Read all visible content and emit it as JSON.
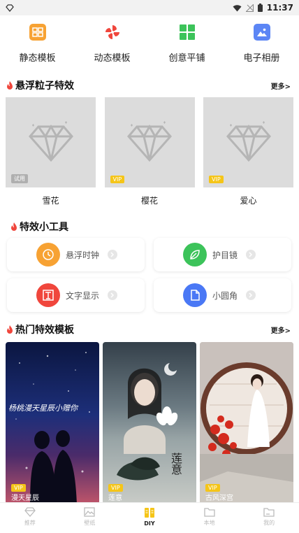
{
  "status_bar": {
    "time": "11:37"
  },
  "quick_categories": [
    {
      "label": "静态模板",
      "icon": "static-template-icon",
      "color": "#f7a233"
    },
    {
      "label": "动态模板",
      "icon": "pinwheel-icon",
      "color": "#f0463c"
    },
    {
      "label": "创意平铺",
      "icon": "grid-icon",
      "color": "#3cc35a"
    },
    {
      "label": "电子相册",
      "icon": "photo-album-icon",
      "color": "#5c86f5"
    }
  ],
  "particle_section": {
    "title": "悬浮粒子特效",
    "more": "更多>"
  },
  "particle_items": [
    {
      "name": "雪花",
      "badge": "试用",
      "badge_type": "trial"
    },
    {
      "name": "樱花",
      "badge": "VIP",
      "badge_type": "vip"
    },
    {
      "name": "爱心",
      "badge": "VIP",
      "badge_type": "vip"
    }
  ],
  "tools_section": {
    "title": "特效小工具"
  },
  "tools": [
    {
      "label": "悬浮时钟",
      "icon": "clock-icon",
      "color": "#f7a233"
    },
    {
      "label": "护目镜",
      "icon": "leaf-icon",
      "color": "#3cc35a"
    },
    {
      "label": "文字显示",
      "icon": "text-display-icon",
      "color": "#f0463c"
    },
    {
      "label": "小圆角",
      "icon": "round-corner-icon",
      "color": "#4a78f5"
    }
  ],
  "hot_section": {
    "title": "热门特效模板",
    "more": "更多>"
  },
  "hot_templates": [
    {
      "name": "漫天星辰",
      "badge": "VIP",
      "overlay_text": "杨桃漫天星辰小赠你"
    },
    {
      "name": "莲意",
      "badge": "VIP",
      "overlay_text": "莲意"
    },
    {
      "name": "古风深宫",
      "badge": "VIP"
    }
  ],
  "bottom_nav": [
    {
      "label": "推荐",
      "icon": "diamond-icon",
      "active": false
    },
    {
      "label": "壁纸",
      "icon": "wallpaper-icon",
      "active": false
    },
    {
      "label": "DIY",
      "icon": "diy-icon",
      "active": true
    },
    {
      "label": "本地",
      "icon": "folder-icon",
      "active": false
    },
    {
      "label": "我的",
      "icon": "profile-folder-icon",
      "active": false
    }
  ],
  "colors": {
    "flame": "#f0463c",
    "vip": "#f5c518",
    "placeholder": "#dcdcdc",
    "active_nav": "#f5c518"
  }
}
